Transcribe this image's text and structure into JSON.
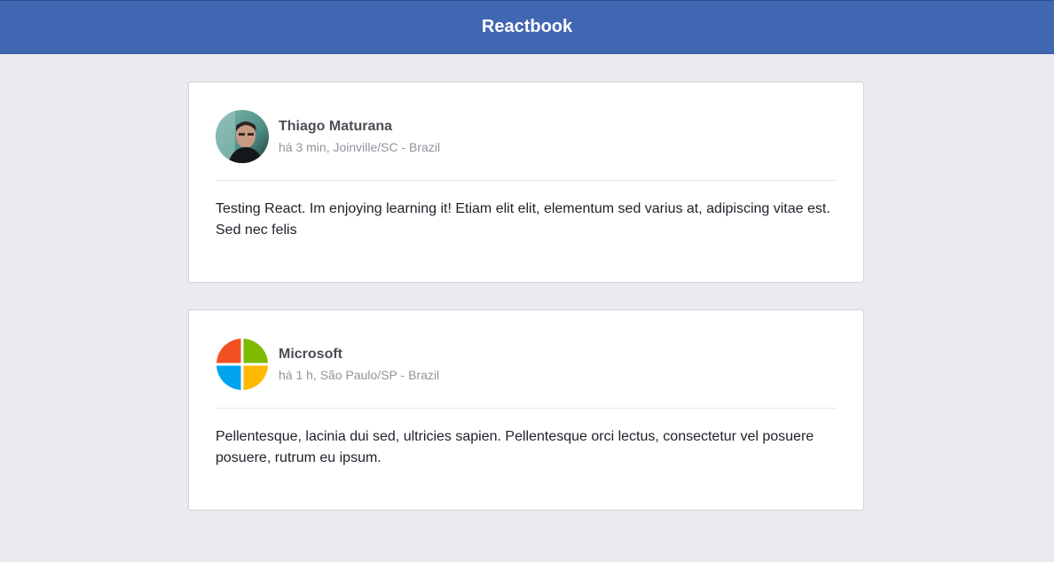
{
  "header": {
    "title": "Reactbook"
  },
  "posts": [
    {
      "author": "Thiago Maturana",
      "meta": "há 3 min, Joinville/SC - Brazil",
      "avatar_icon": "user-photo",
      "content": "Testing React. Im enjoying learning it! Etiam elit elit, elementum sed varius at, adipiscing vitae est. Sed nec felis"
    },
    {
      "author": "Microsoft",
      "meta": "há 1 h, São Paulo/SP - Brazil",
      "avatar_icon": "microsoft-logo",
      "content": "Pellentesque, lacinia dui sed, ultricies sapien. Pellentesque orci lectus, consectetur vel posuere posuere, rutrum eu ipsum."
    }
  ],
  "colors": {
    "header_bg": "#4267b2",
    "page_bg": "#e9ebee",
    "ms_red": "#f25022",
    "ms_green": "#7fba00",
    "ms_blue": "#00a4ef",
    "ms_yellow": "#ffb900"
  }
}
